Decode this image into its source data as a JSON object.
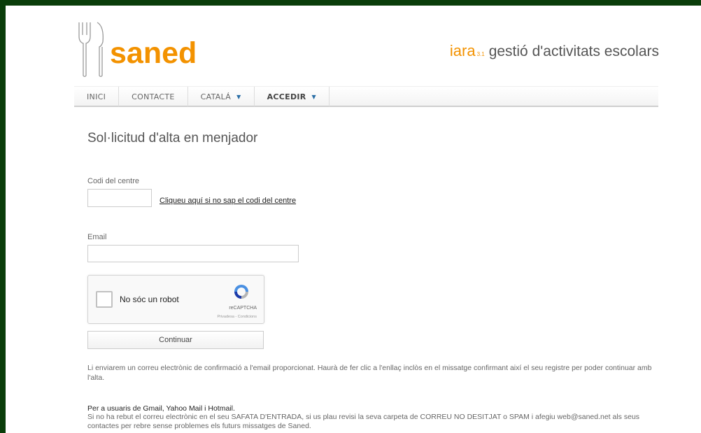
{
  "header": {
    "logo_text": "saned",
    "tagline_brand": "iara",
    "tagline_version": "3.1",
    "tagline_text": "gestió d'activitats escolars"
  },
  "nav": {
    "items": [
      {
        "label": "INICI"
      },
      {
        "label": "CONTACTE"
      },
      {
        "label": "CATALÁ"
      },
      {
        "label": "ACCEDIR"
      }
    ]
  },
  "form": {
    "title": "Sol·licitud d'alta en menjador",
    "code_label": "Codi del centre",
    "code_value": "",
    "code_help_link": "Cliqueu aquí si no sap el codi del centre",
    "email_label": "Email",
    "email_value": "",
    "captcha": {
      "label": "No sóc un robot",
      "brand": "reCAPTCHA",
      "terms": "Privadesa - Condicions"
    },
    "continue_label": "Continuar"
  },
  "info": {
    "confirmation_text": "Li enviarem un correu electrònic de confirmació a l'email proporcionat. Haurà de fer clic a l'enllaç inclòs en el missatge confirmant així el seu registre per poder continuar amb l'alta.",
    "gmail_title": "Per a usuaris de Gmail, Yahoo Mail i Hotmail.",
    "gmail_text": "Si no ha rebut el correu electrònic en el seu SAFATA D'ENTRADA, si us plau revisi la seva carpeta de CORREU NO DESITJAT o SPAM i afegiu web@saned.net als seus contactes per rebre sense problemes els futurs missatges de Saned."
  },
  "colors": {
    "brand_orange": "#f39200",
    "frame_green": "#0a3d0a",
    "nav_caret": "#2a6ea6"
  }
}
